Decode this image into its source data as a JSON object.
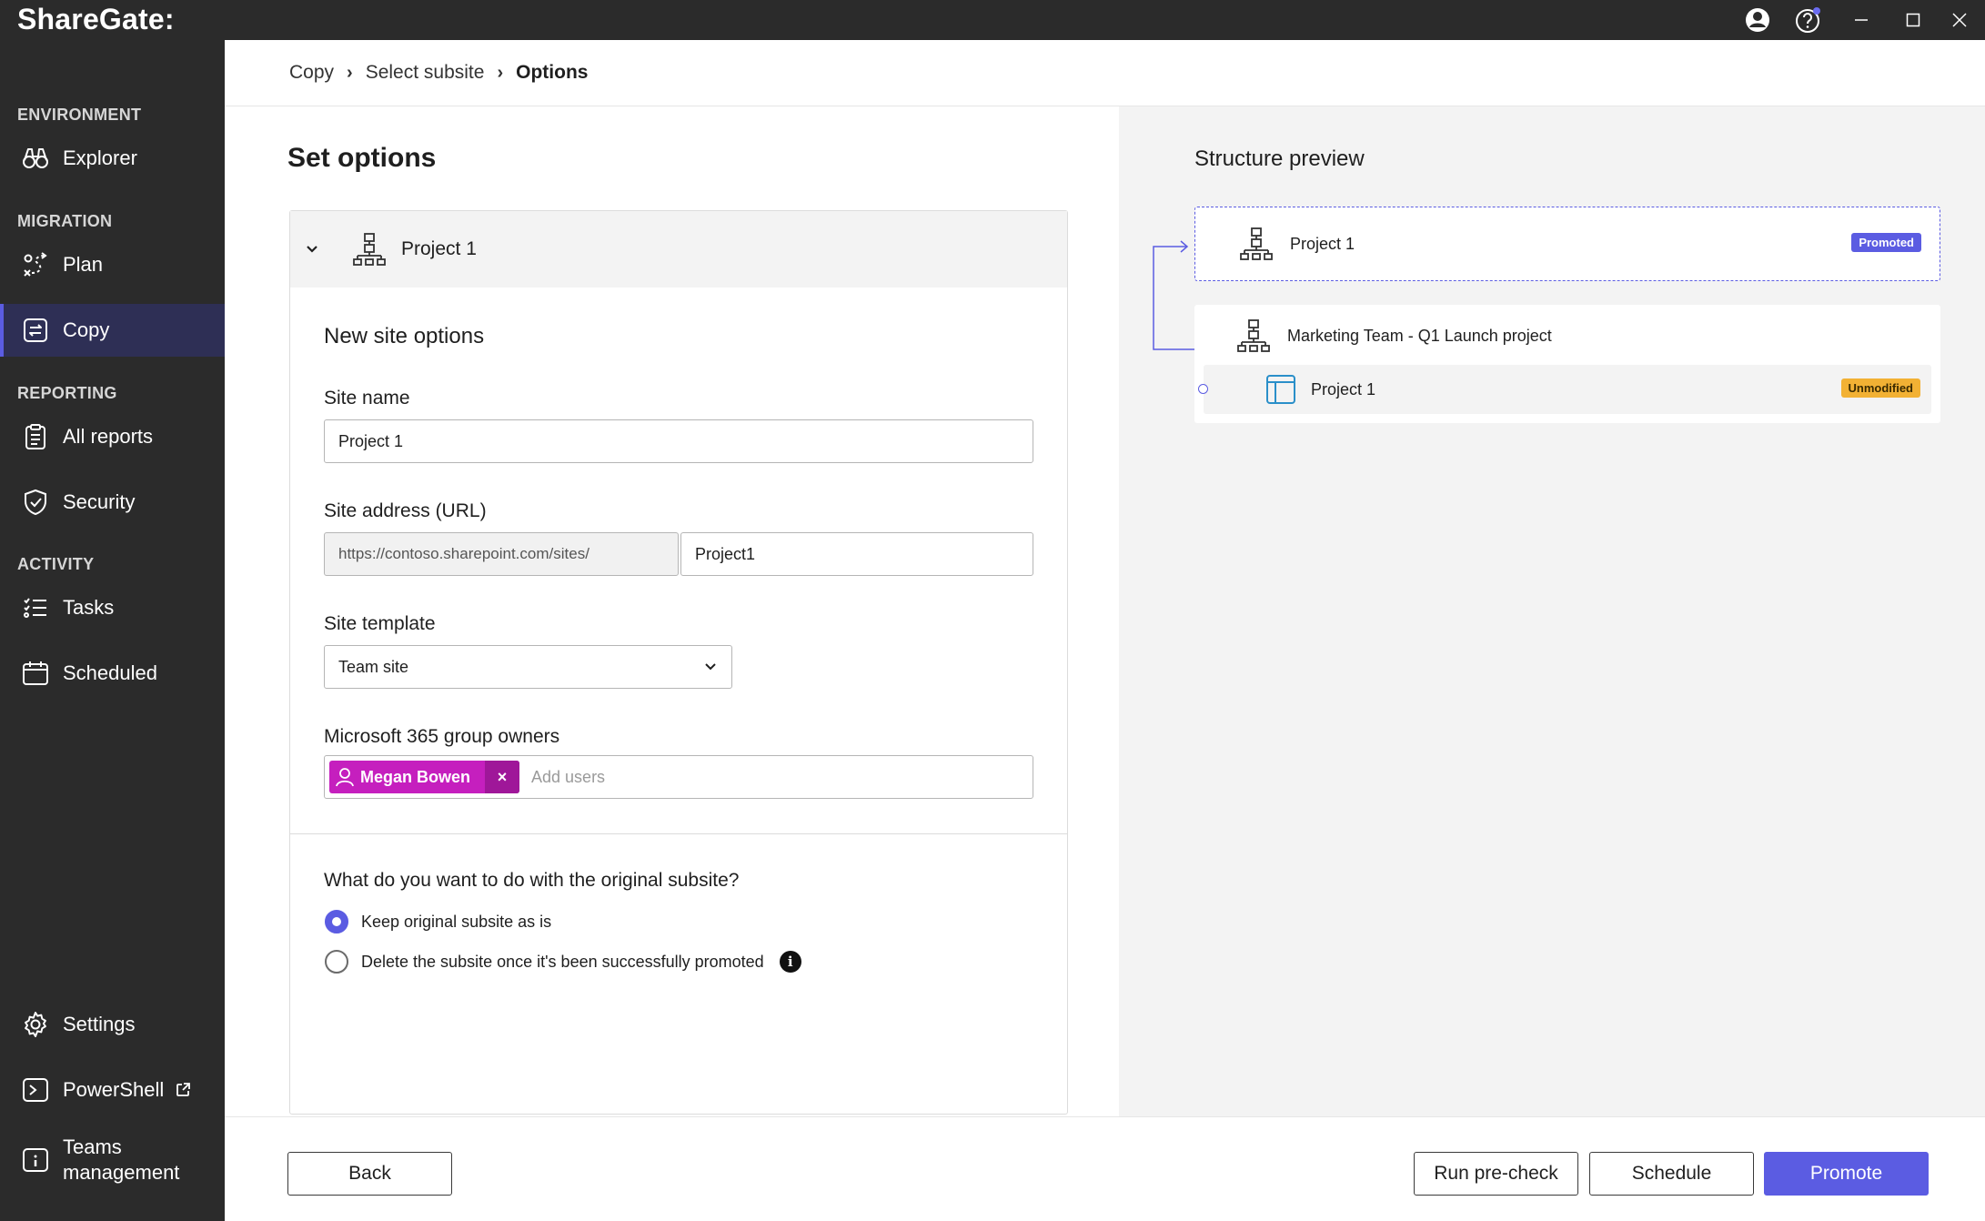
{
  "app": {
    "brand": "ShareGate:"
  },
  "sidebar": {
    "sections": {
      "environment": "ENVIRONMENT",
      "migration": "MIGRATION",
      "reporting": "REPORTING",
      "activity": "ACTIVITY"
    },
    "items": {
      "explorer": "Explorer",
      "plan": "Plan",
      "copy": "Copy",
      "all_reports": "All reports",
      "security": "Security",
      "tasks": "Tasks",
      "scheduled": "Scheduled",
      "settings": "Settings",
      "powershell": "PowerShell",
      "teams_line1": "Teams",
      "teams_line2": "management"
    },
    "active_item": "Copy"
  },
  "breadcrumb": {
    "items": [
      "Copy",
      "Select subsite",
      "Options"
    ],
    "separator": "›"
  },
  "main": {
    "title": "Set options",
    "card": {
      "header_title": "Project 1",
      "section_title": "New site options",
      "site_name": {
        "label": "Site name",
        "value": "Project 1"
      },
      "site_address": {
        "label": "Site address (URL)",
        "prefix": "https://contoso.sharepoint.com/sites/",
        "value": "Project1"
      },
      "site_template": {
        "label": "Site template",
        "value": "Team site"
      },
      "owners": {
        "label": "Microsoft 365 group owners",
        "chip_name": "Megan Bowen",
        "remove_glyph": "×",
        "placeholder": "Add users"
      },
      "question": "What do you want to do with the original subsite?",
      "options": [
        {
          "label": "Keep original subsite as is",
          "checked": true
        },
        {
          "label": "Delete the subsite once it's been successfully promoted",
          "checked": false
        }
      ],
      "info_glyph": "i"
    }
  },
  "preview": {
    "title": "Structure preview",
    "promoted_node": {
      "title": "Project 1",
      "badge": "Promoted"
    },
    "parent_node": {
      "title": "Marketing Team - Q1 Launch project"
    },
    "child_node": {
      "title": "Project 1",
      "badge": "Unmodified"
    }
  },
  "footer": {
    "back": "Back",
    "precheck": "Run pre-check",
    "schedule": "Schedule",
    "promote": "Promote"
  },
  "colors": {
    "accent": "#5b5ce2",
    "sidebar_bg": "#2b2b2b",
    "chip": "#c51fbe",
    "badge_unmodified": "#f2b134"
  }
}
